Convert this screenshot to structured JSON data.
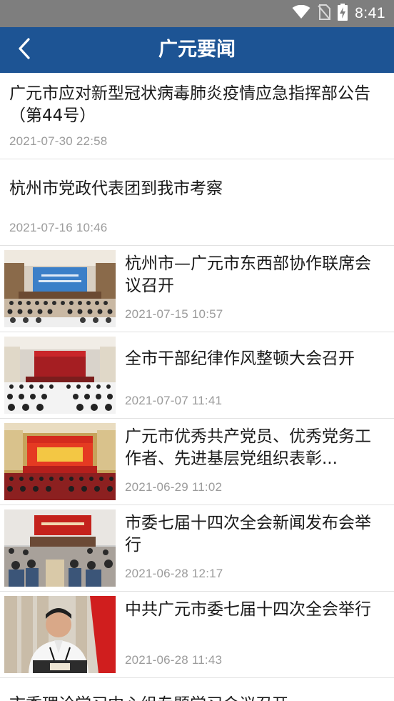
{
  "status_bar": {
    "time": "8:41",
    "icons": [
      "wifi-icon",
      "no-sim-icon",
      "battery-charging-icon"
    ]
  },
  "header": {
    "title": "广元要闻",
    "back_icon": "chevron-left-icon"
  },
  "colors": {
    "app_bar": "#1d5494",
    "status_bar": "#7e7e7e",
    "date_text": "#9b9b9b"
  },
  "news": [
    {
      "title": "广元市应对新型冠状病毒肺炎疫情应急指挥部公告（第44号）",
      "date": "2021-07-30 22:58"
    },
    {
      "title": "杭州市党政代表团到我市考察",
      "date": "2021-07-16 10:46"
    },
    {
      "title": "杭州市—广元市东西部协作联席会议召开",
      "date": "2021-07-15 10:57",
      "thumb": "conference-hall-photo"
    },
    {
      "title": "全市干部纪律作风整顿大会召开",
      "date": "2021-07-07 11:41",
      "thumb": "meeting-hall-red-banner-photo"
    },
    {
      "title": "广元市优秀共产党员、优秀党务工作者、先进基层党组织表彰...",
      "date": "2021-06-29 11:02",
      "thumb": "award-ceremony-stage-photo"
    },
    {
      "title": "市委七届十四次全会新闻发布会举行",
      "date": "2021-06-28 12:17",
      "thumb": "press-conference-photo"
    },
    {
      "title": "中共广元市委七届十四次全会举行",
      "date": "2021-06-28 11:43",
      "thumb": "speaker-at-podium-photo"
    },
    {
      "title": "市委理论学习中心组专题学习会议召开"
    }
  ]
}
